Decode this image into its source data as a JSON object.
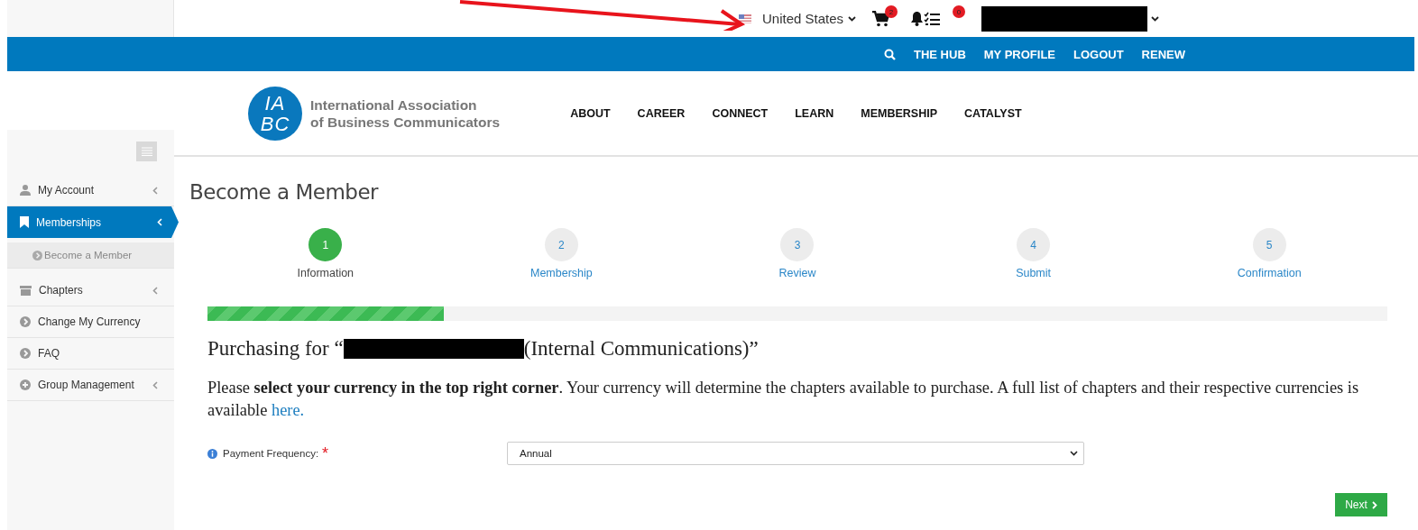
{
  "top_bar": {
    "country": "United States",
    "cart_count": "2",
    "tasks_count": "0"
  },
  "nav": {
    "links": [
      "THE HUB",
      "MY PROFILE",
      "LOGOUT",
      "RENEW"
    ]
  },
  "logo": {
    "mark_top": "IA",
    "mark_bottom": "BC",
    "name_line1": "International Association",
    "name_line2": "of Business Communicators"
  },
  "menu": [
    "ABOUT",
    "CAREER",
    "CONNECT",
    "LEARN",
    "MEMBERSHIP",
    "CATALYST"
  ],
  "sidebar": {
    "items": [
      {
        "label": "My Account",
        "kind": "user",
        "selected": false,
        "expandable": true
      },
      {
        "label": "Memberships",
        "kind": "bookmark",
        "selected": true,
        "expandable": true,
        "children": [
          {
            "label": "Become a Member",
            "selected": true
          }
        ]
      },
      {
        "label": "Chapters",
        "kind": "archive",
        "selected": false,
        "expandable": true
      },
      {
        "label": "Change My Currency",
        "kind": "link",
        "selected": false,
        "expandable": false
      },
      {
        "label": "FAQ",
        "kind": "link",
        "selected": false,
        "expandable": false
      },
      {
        "label": "Group Management",
        "kind": "group",
        "selected": false,
        "expandable": true
      }
    ]
  },
  "page_title": "Become a Member",
  "steps": [
    {
      "number": "1",
      "label": "Information",
      "selected": true
    },
    {
      "number": "2",
      "label": "Membership",
      "selected": false
    },
    {
      "number": "3",
      "label": "Review",
      "selected": false
    },
    {
      "number": "4",
      "label": "Submit",
      "selected": false
    },
    {
      "number": "5",
      "label": "Confirmation",
      "selected": false
    }
  ],
  "progress": {
    "level": 0.2
  },
  "heading": {
    "before": "Purchasing for “",
    "after": "(Internal Communications)”"
  },
  "notice": {
    "text": "Please **select your currency in the top right corner**. Your currency will determine the chapters available to purchase. A full list of chapters and their respective currencies is available ",
    "link": "here."
  },
  "form": {
    "label": "Payment Frequency:",
    "required_mark": "*",
    "value": "Annual"
  },
  "next_button": "Next"
}
